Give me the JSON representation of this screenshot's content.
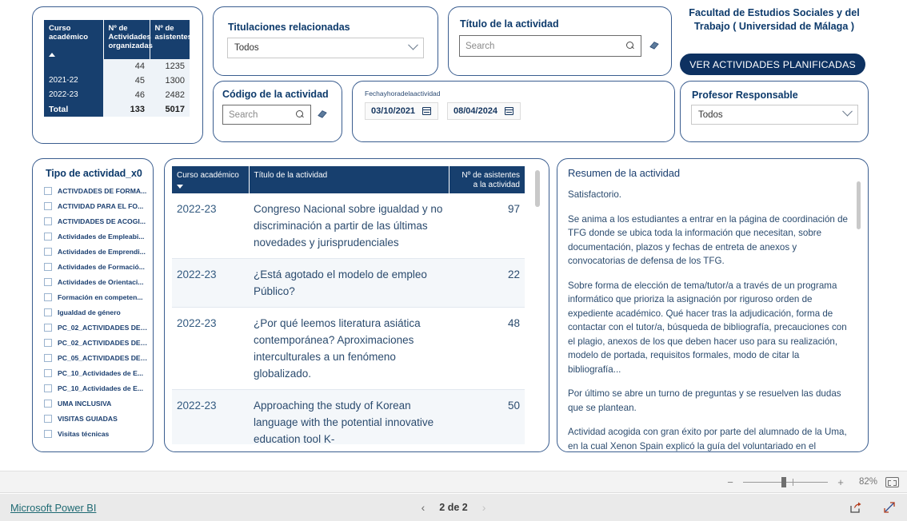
{
  "summary": {
    "columns": [
      "Curso académico",
      "Nº de Actividades organizadas",
      "Nº de asistentes"
    ],
    "col1": "Curso académico",
    "col2": "Nº de\nActividades\norganizadas",
    "col2a": "Nº de",
    "col2b": "Actividades",
    "col2c": "organizadas",
    "col3a": "Nº de",
    "col3b": "asistentes",
    "rows": [
      {
        "curso": "",
        "actividades": "44",
        "asistentes": "1235"
      },
      {
        "curso": "2021-22",
        "actividades": "45",
        "asistentes": "1300"
      },
      {
        "curso": "2022-23",
        "actividades": "46",
        "asistentes": "2482"
      }
    ],
    "total": {
      "label": "Total",
      "actividades": "133",
      "asistentes": "5017"
    }
  },
  "slicers": {
    "titulaciones": {
      "label": "Titulaciones relacionadas",
      "value": "Todos"
    },
    "codigo": {
      "label": "Código de la actividad",
      "placeholder": "Search",
      "value": ""
    },
    "titulo": {
      "label": "Título de la actividad",
      "placeholder": "Search",
      "value": ""
    },
    "fecha": {
      "label": "Fechayhoradelaactividad",
      "from": "03/10/2021",
      "to": "08/04/2024"
    },
    "profesor": {
      "label": "Profesor Responsable",
      "value": "Todos"
    }
  },
  "header": {
    "faculty_line1": "Facultad de Estudios Sociales y del",
    "faculty_line2": "Trabajo ( Universidad de Málaga )",
    "button": "VER ACTIVIDADES PLANIFICADAS"
  },
  "tipo_actividad": {
    "title": "Tipo de actividad_x0",
    "items": [
      "ACTIVDADES DE FORMA...",
      "ACTIVIDAD PARA EL FO...",
      "ACTIVIDADES DE ACOGI...",
      "Actividades de Empleabi...",
      "Actividades de Emprendi...",
      "Actividades de Formació...",
      "Actividades de Orientaci...",
      "Formación en competen...",
      "Igualdad de género",
      "PC_02_ACTIVIDADES DE ...",
      "PC_02_ACTIVIDADES DE ...",
      "PC_05_ACTIVIDADES DE ...",
      "PC_10_Actividades de E...",
      "PC_10_Actividades de E...",
      "UMA INCLUSIVA",
      "VISITAS GUIADAS",
      "Visitas técnicas"
    ]
  },
  "activities_table": {
    "headers": {
      "curso": "Curso académico",
      "titulo": "Título de la actividad",
      "asistentes_l1": "Nº de asistentes",
      "asistentes_l2": "a la actividad"
    },
    "rows": [
      {
        "curso": "2022-23",
        "titulo": "Congreso Nacional sobre igualdad y no discriminación a partir de las últimas novedades y jurisprudenciales",
        "asistentes": "97"
      },
      {
        "curso": "2022-23",
        "titulo": "¿Está agotado el modelo de empleo Público?",
        "asistentes": "22"
      },
      {
        "curso": "2022-23",
        "titulo": "¿Por qué leemos literatura asiática contemporánea? Aproximaciones interculturales a un fenómeno globalizado.",
        "asistentes": "48"
      },
      {
        "curso": "2022-23",
        "titulo": "Approaching the study of Korean language with the potential innovative education tool K-",
        "asistentes": "50"
      }
    ]
  },
  "resumen": {
    "title": "Resumen de la actividad",
    "paragraphs": [
      "Satisfactorio.",
      "Se anima  a los estudiantes a entrar en la página de coordinación de TFG donde se ubica toda la información que necesitan, sobre documentación, plazos y fechas de entreta de anexos y convocatorias de defensa de los TFG.",
      "Sobre forma de elección de tema/tutor/a a través de un programa informático que prioriza la asignación por riguroso orden de expediente académico. Qué hacer tras la adjudicación, forma de contactar con el tutor/a, búsqueda de bibliografía, precauciones con el plagio, anexos de los que deben hacer uso para su realización, modelo de portada, requisitos formales, modo de citar la bibliografía...",
      "Por último se abre un turno de preguntas y se resuelven las dudas que se plantean.",
      "Actividad acogida con gran éxito por parte del alumnado de la Uma, en la cual Xenon Spain explicó la guía del voluntariado en el colectivo"
    ]
  },
  "status_bar": {
    "minus": "−",
    "plus": "+",
    "zoom": "82%"
  },
  "footer": {
    "brand": "Microsoft Power BI",
    "prev": "‹",
    "next": "›",
    "page": "2 de 2"
  },
  "colors": {
    "navy_header": "#173f6e",
    "brand_blue": "#0d3161",
    "card_border": "#3a5d8f",
    "link_teal": "#1f6a73",
    "row_alt": "#f4f7fa"
  }
}
